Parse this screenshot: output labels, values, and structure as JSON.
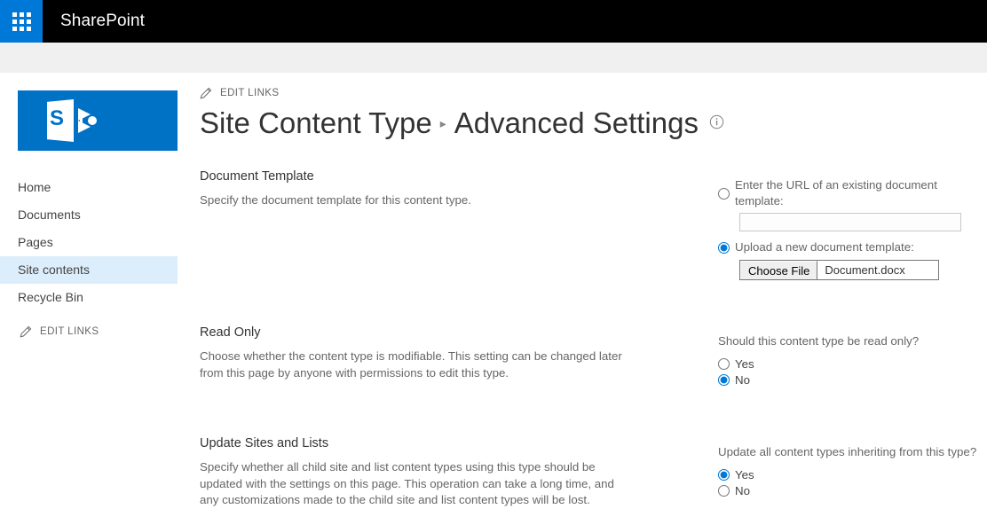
{
  "suite_bar": {
    "waffle_icon": "app-launcher-waffle-icon",
    "title": "SharePoint"
  },
  "sidebar": {
    "logo_alt": "sharepoint-site-logo",
    "items": [
      {
        "label": "Home",
        "selected": false
      },
      {
        "label": "Documents",
        "selected": false
      },
      {
        "label": "Pages",
        "selected": false
      },
      {
        "label": "Site contents",
        "selected": true
      },
      {
        "label": "Recycle Bin",
        "selected": false
      }
    ],
    "edit_links_label": "EDIT LINKS",
    "edit_links_icon": "pencil-icon"
  },
  "header": {
    "edit_links_label": "EDIT LINKS",
    "edit_links_icon": "pencil-icon",
    "title_primary": "Site Content Type",
    "title_separator": "▸",
    "title_secondary": "Advanced Settings",
    "info_icon": "info-circle-icon"
  },
  "sections": {
    "document_template": {
      "heading": "Document Template",
      "description": "Specify the document template for this content type.",
      "url_option_label": "Enter the URL of an existing document template:",
      "url_option_selected": false,
      "url_value": "",
      "url_placeholder": "",
      "upload_option_label": "Upload a new document template:",
      "upload_option_selected": true,
      "choose_file_button": "Choose File",
      "chosen_file_name": "Document.docx"
    },
    "read_only": {
      "heading": "Read Only",
      "description": "Choose whether the content type is modifiable. This setting can be changed later from this page by anyone with permissions to edit this type.",
      "question": "Should this content type be read only?",
      "options": [
        {
          "label": "Yes",
          "selected": false
        },
        {
          "label": "No",
          "selected": true
        }
      ]
    },
    "update_sites_and_lists": {
      "heading": "Update Sites and Lists",
      "description": "Specify whether all child site and list content types using this type should be updated with the settings on this page. This operation can take a long time, and any customizations made to the child site and list content types will be lost.",
      "question": "Update all content types inheriting from this type?",
      "options": [
        {
          "label": "Yes",
          "selected": true
        },
        {
          "label": "No",
          "selected": false
        }
      ]
    }
  },
  "colors": {
    "suite_bar_bg": "#000000",
    "waffle_bg": "#0078d7",
    "accent": "#0072c6",
    "selected_nav_bg": "#dceefb"
  }
}
